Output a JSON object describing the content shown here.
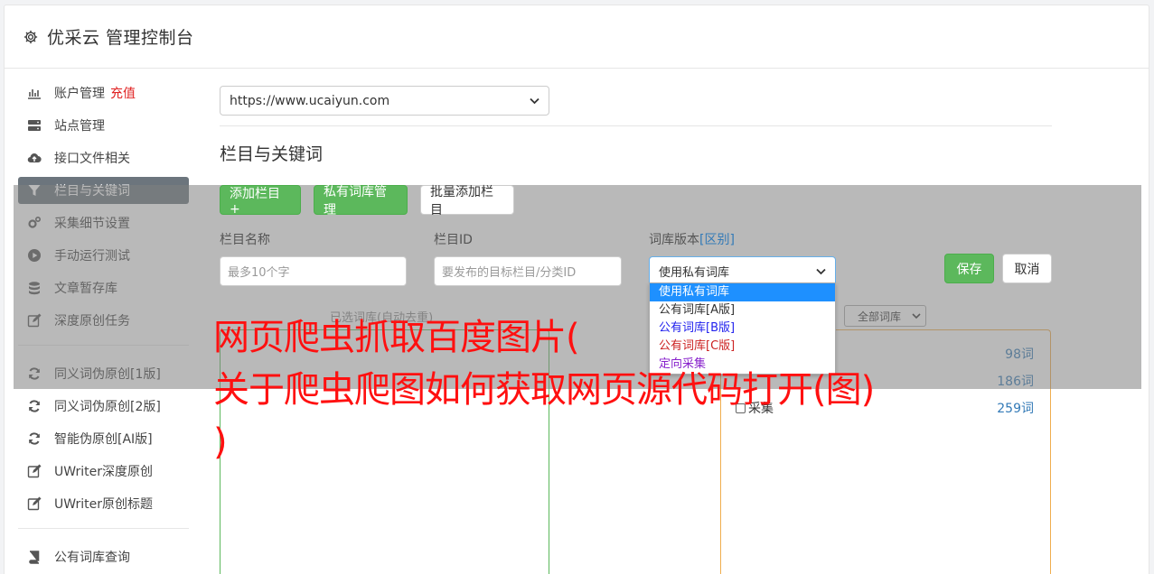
{
  "header": {
    "title": "优采云 管理控制台",
    "icon": "gear-icon"
  },
  "sidebar": {
    "items": [
      {
        "label": "账户管理",
        "extra": "充值",
        "icon": "bar-chart-icon"
      },
      {
        "label": "站点管理",
        "icon": "server-icon"
      },
      {
        "label": "接口文件相关",
        "icon": "cloud-upload-icon"
      },
      {
        "label": "栏目与关键词",
        "icon": "filter-icon",
        "active": true
      },
      {
        "label": "采集细节设置",
        "icon": "cogs-icon"
      },
      {
        "label": "手动运行测试",
        "icon": "play-circle-icon"
      },
      {
        "label": "文章暂存库",
        "icon": "database-icon"
      },
      {
        "label": "深度原创任务",
        "icon": "edit-icon"
      },
      {
        "label": "同义词伪原创[1版]",
        "icon": "refresh-icon"
      },
      {
        "label": "同义词伪原创[2版]",
        "icon": "refresh-icon"
      },
      {
        "label": "智能伪原创[AI版]",
        "icon": "refresh-icon"
      },
      {
        "label": "UWriter深度原创",
        "icon": "edit-icon"
      },
      {
        "label": "UWriter原创标题",
        "icon": "edit-icon"
      },
      {
        "label": "公有词库查询",
        "icon": "book-icon"
      }
    ]
  },
  "main": {
    "site_select": "https://www.ucaiyun.com",
    "section_title": "栏目与关键词",
    "toolbar": {
      "add_column": "添加栏目 +",
      "private_lib": "私有词库管理",
      "batch_add": "批量添加栏目"
    },
    "form": {
      "column_name_label": "栏目名称",
      "column_name_placeholder": "最多10个字",
      "column_id_label": "栏目ID",
      "column_id_placeholder": "要发布的目标栏目/分类ID",
      "lib_version_label": "词库版本",
      "lib_version_link": "[区别]",
      "lib_version_value": "使用私有词库",
      "save": "保存",
      "cancel": "取消"
    },
    "dropdown_options": [
      {
        "label": "使用私有词库",
        "style": "selected"
      },
      {
        "label": "公有词库[A版]",
        "style": "default"
      },
      {
        "label": "公有词库[B版]",
        "style": "blue"
      },
      {
        "label": "公有词库[C版]",
        "style": "red"
      },
      {
        "label": "定向采集",
        "style": "purple"
      }
    ],
    "selected_panel_title": "已选词库(自动去重)",
    "lib_filter": "全部词库",
    "libraries": [
      {
        "name": "",
        "count": "98词"
      },
      {
        "name": "",
        "count": "186词"
      },
      {
        "name": "采集",
        "count": "259词"
      }
    ]
  },
  "watermark": {
    "line1": "网页爬虫抓取百度图片(",
    "line2": "关于爬虫爬图如何获取网页源代码打开(图)",
    "line3": ")"
  }
}
